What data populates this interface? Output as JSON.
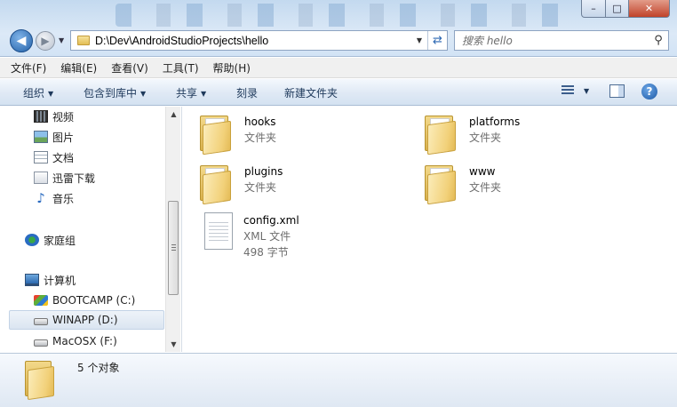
{
  "window": {
    "controls": {
      "minimize": "–",
      "maximize": "□",
      "close": "✕"
    }
  },
  "nav": {
    "back_icon": "back-arrow-icon",
    "back_glyph": "◀",
    "forward_glyph": "▶",
    "address_path": "D:\\Dev\\AndroidStudioProjects\\hello",
    "search_placeholder": "搜索 hello"
  },
  "menu": [
    "文件(F)",
    "编辑(E)",
    "查看(V)",
    "工具(T)",
    "帮助(H)"
  ],
  "commands": {
    "organize": "组织",
    "include_in_library": "包含到库中",
    "share": "共享",
    "burn": "刻录",
    "new_folder": "新建文件夹"
  },
  "sidebar": {
    "libraries": [
      {
        "label": "视频",
        "icon": "video-icon"
      },
      {
        "label": "图片",
        "icon": "picture-icon"
      },
      {
        "label": "文档",
        "icon": "document-icon"
      },
      {
        "label": "迅雷下载",
        "icon": "download-icon"
      },
      {
        "label": "音乐",
        "icon": "music-icon"
      }
    ],
    "homegroup": "家庭组",
    "computer": "计算机",
    "drives": [
      {
        "label": "BOOTCAMP (C:)",
        "icon": "windows-drive-icon",
        "selected": false
      },
      {
        "label": "WINAPP (D:)",
        "icon": "drive-icon",
        "selected": true
      },
      {
        "label": "MacOSX (F:)",
        "icon": "drive-icon",
        "selected": false
      }
    ]
  },
  "files": [
    {
      "name": "hooks",
      "type": "文件夹",
      "icon": "folder-icon"
    },
    {
      "name": "platforms",
      "type": "文件夹",
      "icon": "folder-icon"
    },
    {
      "name": "plugins",
      "type": "文件夹",
      "icon": "folder-icon"
    },
    {
      "name": "www",
      "type": "文件夹",
      "icon": "folder-icon"
    },
    {
      "name": "config.xml",
      "type": "XML 文件",
      "size": "498 字节",
      "icon": "xml-file-icon"
    }
  ],
  "status": {
    "item_count": "5 个对象"
  },
  "colors": {
    "accent": "#1e395b",
    "selection": "#dbe5f1",
    "folder": "#f2d17a"
  }
}
